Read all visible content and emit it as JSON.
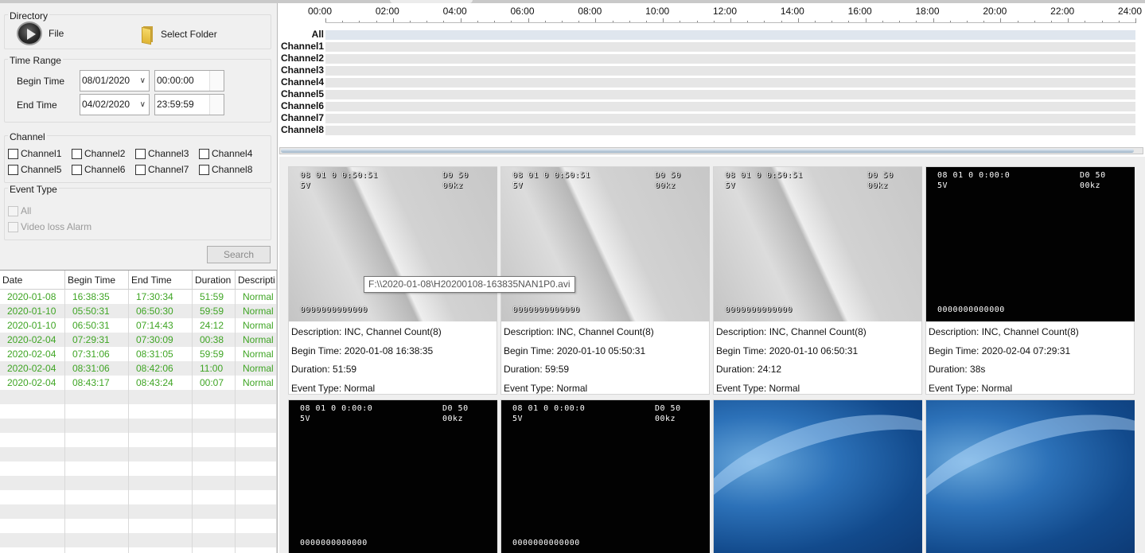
{
  "directory": {
    "title": "Directory",
    "file_label": "File",
    "select_folder_label": "Select Folder"
  },
  "time_range": {
    "title": "Time Range",
    "begin_label": "Begin Time",
    "begin_date": "08/01/2020",
    "begin_time": "00:00:00",
    "end_label": "End Time",
    "end_date": "04/02/2020",
    "end_time": "23:59:59"
  },
  "channel": {
    "title": "Channel",
    "items": [
      "Channel1",
      "Channel2",
      "Channel3",
      "Channel4",
      "Channel5",
      "Channel6",
      "Channel7",
      "Channel8"
    ]
  },
  "event_type": {
    "title": "Event Type",
    "items": [
      "All",
      "Video loss Alarm"
    ]
  },
  "search_label": "Search",
  "table": {
    "columns": [
      "Date",
      "Begin Time",
      "End Time",
      "Duration",
      "Descripti"
    ],
    "rows": [
      [
        "2020-01-08",
        "16:38:35",
        "17:30:34",
        "51:59",
        "Normal"
      ],
      [
        "2020-01-10",
        "05:50:31",
        "06:50:30",
        "59:59",
        "Normal"
      ],
      [
        "2020-01-10",
        "06:50:31",
        "07:14:43",
        "24:12",
        "Normal"
      ],
      [
        "2020-02-04",
        "07:29:31",
        "07:30:09",
        "00:38",
        "Normal"
      ],
      [
        "2020-02-04",
        "07:31:06",
        "08:31:05",
        "59:59",
        "Normal"
      ],
      [
        "2020-02-04",
        "08:31:06",
        "08:42:06",
        "11:00",
        "Normal"
      ],
      [
        "2020-02-04",
        "08:43:17",
        "08:43:24",
        "00:07",
        "Normal"
      ]
    ],
    "text_color": "#3fa524"
  },
  "timeline": {
    "hours": [
      "00:00",
      "02:00",
      "04:00",
      "06:00",
      "08:00",
      "10:00",
      "12:00",
      "14:00",
      "16:00",
      "18:00",
      "20:00",
      "22:00",
      "24:00"
    ],
    "rows": [
      "All",
      "Channel1",
      "Channel2",
      "Channel3",
      "Channel4",
      "Channel5",
      "Channel6",
      "Channel7",
      "Channel8"
    ]
  },
  "cards": [
    {
      "style": "gray",
      "osd_top_left": "08 01 0 0:50:51",
      "osd_sub_left": "5V",
      "osd_top_right": "D0 50",
      "osd_sub_right": "00kz",
      "osd_bottom": "0000000000000",
      "description": "Description: INC, Channel Count(8)",
      "begin": "Begin Time: 2020-01-08 16:38:35",
      "duration": "Duration: 51:59",
      "event": "Event Type: Normal"
    },
    {
      "style": "gray",
      "osd_top_left": "08 01 0 0:50:51",
      "osd_sub_left": "5V",
      "osd_top_right": "D0 50",
      "osd_sub_right": "00kz",
      "osd_bottom": "0000000000000",
      "description": "Description: INC, Channel Count(8)",
      "begin": "Begin Time: 2020-01-10 05:50:31",
      "duration": "Duration: 59:59",
      "event": "Event Type: Normal"
    },
    {
      "style": "gray",
      "osd_top_left": "08 01 0 0:50:51",
      "osd_sub_left": "5V",
      "osd_top_right": "D0 50",
      "osd_sub_right": "00kz",
      "osd_bottom": "0000000000000",
      "description": "Description: INC, Channel Count(8)",
      "begin": "Begin Time: 2020-01-10 06:50:31",
      "duration": "Duration: 24:12",
      "event": "Event Type: Normal"
    },
    {
      "style": "black",
      "osd_top_left": "08 01 0 0:00:0",
      "osd_sub_left": "5V",
      "osd_top_right": "D0 50",
      "osd_sub_right": "00kz",
      "osd_bottom": "0000000000000",
      "description": "Description: INC, Channel Count(8)",
      "begin": "Begin Time: 2020-02-04 07:29:31",
      "duration": "Duration: 38s",
      "event": "Event Type: Normal"
    },
    {
      "style": "black",
      "osd_top_left": "08 01 0 0:00:0",
      "osd_sub_left": "5V",
      "osd_top_right": "D0 50",
      "osd_sub_right": "00kz",
      "osd_bottom": "0000000000000"
    },
    {
      "style": "black",
      "osd_top_left": "08 01 0 0:00:0",
      "osd_sub_left": "5V",
      "osd_top_right": "D0 50",
      "osd_sub_right": "00kz",
      "osd_bottom": "0000000000000"
    },
    {
      "style": "blue"
    },
    {
      "style": "blue"
    }
  ],
  "tooltip": "F:\\\\2020-01-08\\H20200108-163835NAN1P0.avi",
  "icons": {
    "file": "play-disc-icon",
    "folder": "folder-icon",
    "dropdown": "chevron-down-icon"
  }
}
